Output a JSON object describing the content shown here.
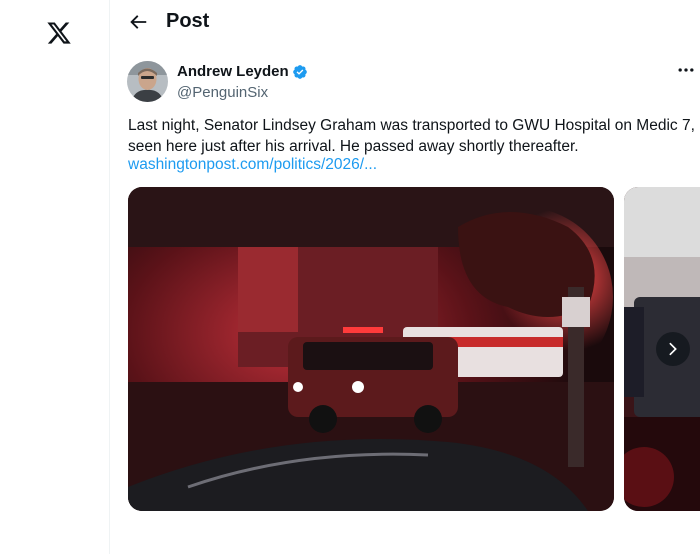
{
  "header": {
    "title": "Post"
  },
  "author": {
    "display_name": "Andrew Leyden",
    "handle": "@PenguinSix"
  },
  "tweet": {
    "line1": "Last night, Senator Lindsey Graham was transported to GWU Hospital on Medic 7,",
    "line2": "seen here just after his arrival. He passed away shortly thereafter.",
    "link": "washingtonpost.com/politics/2026/..."
  },
  "icons": {
    "logo": "x-logo",
    "back": "arrow-left-icon",
    "verified": "verified-badge-icon",
    "more": "more-horizontal-icon",
    "next": "chevron-right-icon"
  },
  "colors": {
    "text": "#0f1419",
    "secondary": "#536471",
    "link": "#1d9bf0",
    "border": "#eff3f4"
  }
}
